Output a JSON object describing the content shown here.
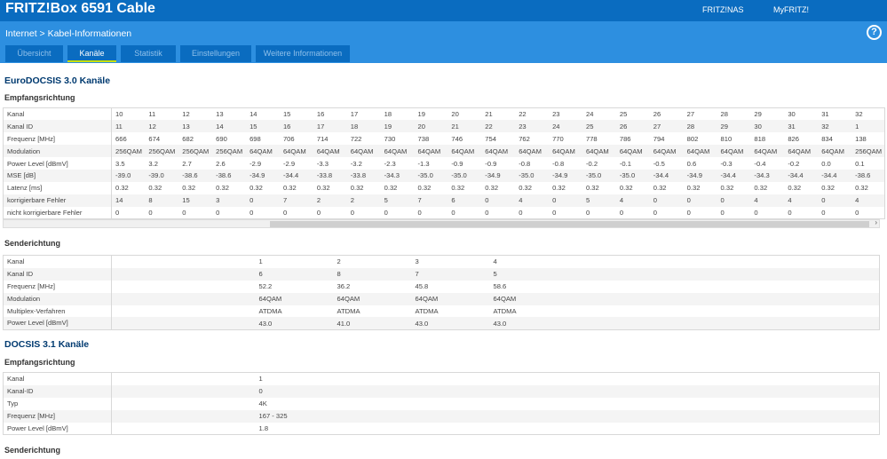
{
  "header": {
    "title": "FRITZ!Box 6591 Cable",
    "links": [
      "FRITZ!NAS",
      "MyFRITZ!"
    ],
    "help": "?"
  },
  "breadcrumb": {
    "section": "Internet",
    "separator": ">",
    "page": "Kabel-Informationen"
  },
  "tabs": [
    "Übersicht",
    "Kanäle",
    "Statistik",
    "Einstellungen",
    "Weitere Informationen"
  ],
  "active_tab": "Kanäle",
  "docsis30": {
    "title": "EuroDOCSIS 3.0 Kanäle",
    "downstream": {
      "title": "Empfangsrichtung",
      "rows": [
        {
          "label": "Kanal",
          "values": [
            "10",
            "11",
            "12",
            "13",
            "14",
            "15",
            "16",
            "17",
            "18",
            "19",
            "20",
            "21",
            "22",
            "23",
            "24",
            "25",
            "26",
            "27",
            "28",
            "29",
            "30",
            "31",
            "32"
          ]
        },
        {
          "label": "Kanal ID",
          "values": [
            "11",
            "12",
            "13",
            "14",
            "15",
            "16",
            "17",
            "18",
            "19",
            "20",
            "21",
            "22",
            "23",
            "24",
            "25",
            "26",
            "27",
            "28",
            "29",
            "30",
            "31",
            "32",
            "1"
          ]
        },
        {
          "label": "Frequenz [MHz]",
          "values": [
            "666",
            "674",
            "682",
            "690",
            "698",
            "706",
            "714",
            "722",
            "730",
            "738",
            "746",
            "754",
            "762",
            "770",
            "778",
            "786",
            "794",
            "802",
            "810",
            "818",
            "826",
            "834",
            "138"
          ]
        },
        {
          "label": "Modulation",
          "values": [
            "256QAM",
            "256QAM",
            "256QAM",
            "256QAM",
            "64QAM",
            "64QAM",
            "64QAM",
            "64QAM",
            "64QAM",
            "64QAM",
            "64QAM",
            "64QAM",
            "64QAM",
            "64QAM",
            "64QAM",
            "64QAM",
            "64QAM",
            "64QAM",
            "64QAM",
            "64QAM",
            "64QAM",
            "64QAM",
            "256QAM"
          ]
        },
        {
          "label": "Power Level [dBmV]",
          "values": [
            "3.5",
            "3.2",
            "2.7",
            "2.6",
            "-2.9",
            "-2.9",
            "-3.3",
            "-3.2",
            "-2.3",
            "-1.3",
            "-0.9",
            "-0.9",
            "-0.8",
            "-0.8",
            "-0.2",
            "-0.1",
            "-0.5",
            "0.6",
            "-0.3",
            "-0.4",
            "-0.2",
            "0.0",
            "0.1"
          ]
        },
        {
          "label": "MSE [dB]",
          "values": [
            "-39.0",
            "-39.0",
            "-38.6",
            "-38.6",
            "-34.9",
            "-34.4",
            "-33.8",
            "-33.8",
            "-34.3",
            "-35.0",
            "-35.0",
            "-34.9",
            "-35.0",
            "-34.9",
            "-35.0",
            "-35.0",
            "-34.4",
            "-34.9",
            "-34.4",
            "-34.3",
            "-34.4",
            "-34.4",
            "-38.6"
          ]
        },
        {
          "label": "Latenz [ms]",
          "values": [
            "0.32",
            "0.32",
            "0.32",
            "0.32",
            "0.32",
            "0.32",
            "0.32",
            "0.32",
            "0.32",
            "0.32",
            "0.32",
            "0.32",
            "0.32",
            "0.32",
            "0.32",
            "0.32",
            "0.32",
            "0.32",
            "0.32",
            "0.32",
            "0.32",
            "0.32",
            "0.32"
          ]
        },
        {
          "label": "korrigierbare Fehler",
          "values": [
            "14",
            "8",
            "15",
            "3",
            "0",
            "7",
            "2",
            "2",
            "5",
            "7",
            "6",
            "0",
            "4",
            "0",
            "5",
            "4",
            "0",
            "0",
            "0",
            "4",
            "4",
            "0",
            "4"
          ]
        },
        {
          "label": "nicht korrigierbare Fehler",
          "values": [
            "0",
            "0",
            "0",
            "0",
            "0",
            "0",
            "0",
            "0",
            "0",
            "0",
            "0",
            "0",
            "0",
            "0",
            "0",
            "0",
            "0",
            "0",
            "0",
            "0",
            "0",
            "0",
            "0"
          ]
        }
      ]
    },
    "upstream": {
      "title": "Senderichtung",
      "rows": [
        {
          "label": "Kanal",
          "values": [
            "1",
            "2",
            "3",
            "4"
          ]
        },
        {
          "label": "Kanal ID",
          "values": [
            "6",
            "8",
            "7",
            "5"
          ]
        },
        {
          "label": "Frequenz [MHz]",
          "values": [
            "52.2",
            "36.2",
            "45.8",
            "58.6"
          ]
        },
        {
          "label": "Modulation",
          "values": [
            "64QAM",
            "64QAM",
            "64QAM",
            "64QAM"
          ]
        },
        {
          "label": "Multiplex-Verfahren",
          "values": [
            "ATDMA",
            "ATDMA",
            "ATDMA",
            "ATDMA"
          ]
        },
        {
          "label": "Power Level [dBmV]",
          "values": [
            "43.0",
            "41.0",
            "43.0",
            "43.0"
          ]
        }
      ]
    }
  },
  "docsis31": {
    "title": "DOCSIS 3.1 Kanäle",
    "downstream": {
      "title": "Empfangsrichtung",
      "rows": [
        {
          "label": "Kanal",
          "values": [
            "1"
          ]
        },
        {
          "label": "Kanal-ID",
          "values": [
            "0"
          ]
        },
        {
          "label": "Typ",
          "values": [
            "4K"
          ]
        },
        {
          "label": "Frequenz [MHz]",
          "values": [
            "167 - 325"
          ]
        },
        {
          "label": "Power Level [dBmV]",
          "values": [
            "1.8"
          ]
        }
      ]
    },
    "upstream": {
      "title": "Senderichtung"
    }
  }
}
